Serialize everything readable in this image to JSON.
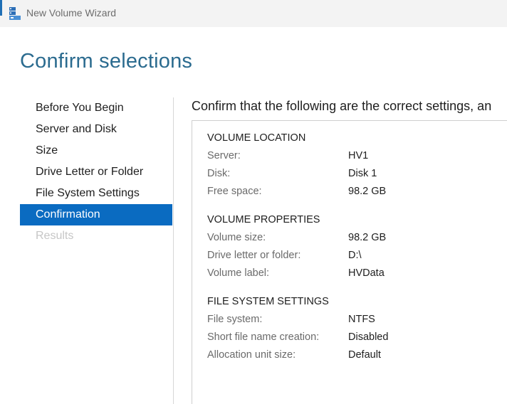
{
  "window": {
    "title": "New Volume Wizard",
    "icon": "server-manager-icon"
  },
  "page_title": "Confirm selections",
  "nav": {
    "items": [
      {
        "label": "Before You Begin",
        "state": "normal"
      },
      {
        "label": "Server and Disk",
        "state": "normal"
      },
      {
        "label": "Size",
        "state": "normal"
      },
      {
        "label": "Drive Letter or Folder",
        "state": "normal"
      },
      {
        "label": "File System Settings",
        "state": "normal"
      },
      {
        "label": "Confirmation",
        "state": "active"
      },
      {
        "label": "Results",
        "state": "disabled"
      }
    ]
  },
  "intro_text": "Confirm that the following are the correct settings, an",
  "summary": {
    "sections": [
      {
        "title": "VOLUME LOCATION",
        "rows": [
          {
            "label": "Server:",
            "value": "HV1"
          },
          {
            "label": "Disk:",
            "value": "Disk 1"
          },
          {
            "label": "Free space:",
            "value": "98.2 GB"
          }
        ]
      },
      {
        "title": "VOLUME PROPERTIES",
        "rows": [
          {
            "label": "Volume size:",
            "value": "98.2 GB"
          },
          {
            "label": "Drive letter or folder:",
            "value": "D:\\"
          },
          {
            "label": "Volume label:",
            "value": "HVData"
          }
        ]
      },
      {
        "title": "FILE SYSTEM SETTINGS",
        "rows": [
          {
            "label": "File system:",
            "value": "NTFS"
          },
          {
            "label": "Short file name creation:",
            "value": "Disabled"
          },
          {
            "label": "Allocation unit size:",
            "value": "Default"
          }
        ]
      }
    ]
  },
  "colors": {
    "accent": "#0a6bc1",
    "title": "#2b6b8f",
    "disabled": "#c6c6c6"
  }
}
